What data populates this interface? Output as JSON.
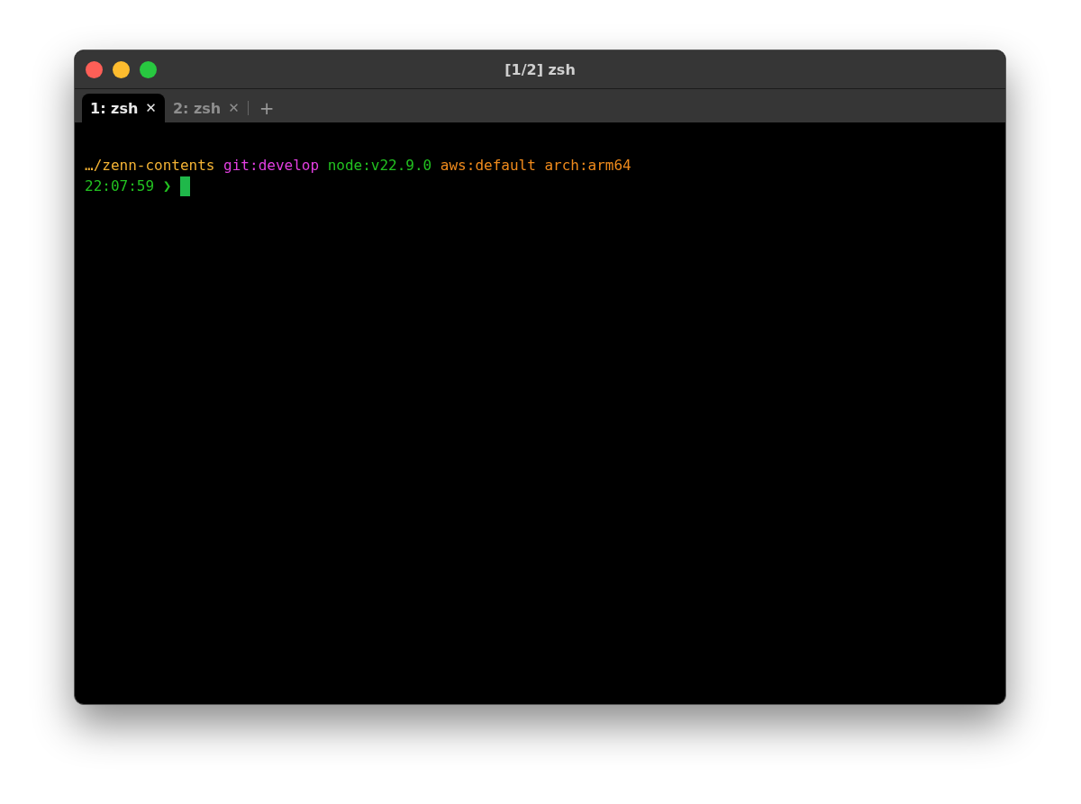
{
  "window": {
    "title": "[1/2] zsh"
  },
  "tabs": [
    {
      "label": "1: zsh",
      "close": "✕",
      "selected": true
    },
    {
      "label": "2: zsh",
      "close": "✕",
      "selected": false
    }
  ],
  "new_tab": "+",
  "terminal": {
    "lines": [
      {
        "segments": [
          {
            "text": "…/zenn-contents",
            "color": "#f3b234"
          },
          {
            "text": "git:develop",
            "color": "#e23fe0"
          },
          {
            "text": "node:v22.9.0",
            "color": "#22c020"
          },
          {
            "text": "aws:default",
            "color": "#ef8a1c"
          },
          {
            "text": "arch:arm64",
            "color": "#ef8a1c"
          }
        ]
      },
      {
        "segments": [
          {
            "text": "22:07:59",
            "color": "#22c020"
          },
          {
            "text": "❯",
            "color": "#22c020"
          }
        ],
        "cursor": true
      }
    ]
  }
}
